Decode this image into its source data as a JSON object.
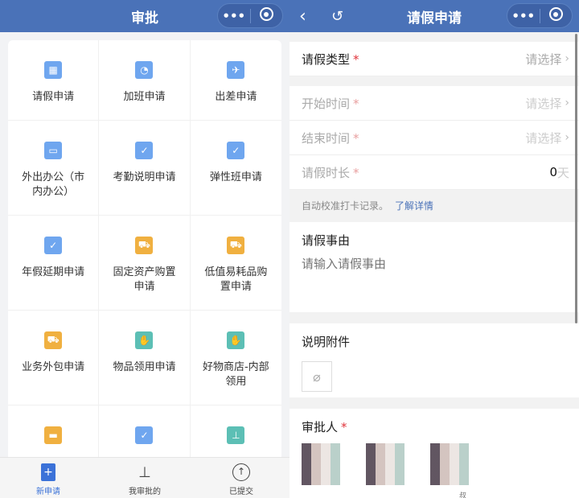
{
  "left": {
    "title": "审批",
    "grid": [
      {
        "label": "请假申请",
        "icon": "calendar-icon",
        "color": "#6fa6ef"
      },
      {
        "label": "加班申请",
        "icon": "user-clock-icon",
        "color": "#6fa6ef"
      },
      {
        "label": "出差申请",
        "icon": "plane-icon",
        "color": "#6fa6ef"
      },
      {
        "label": "外出办公（市内办公）",
        "icon": "briefcase-icon",
        "color": "#6fa6ef"
      },
      {
        "label": "考勤说明申请",
        "icon": "clipboard-check-icon",
        "color": "#6fa6ef"
      },
      {
        "label": "弹性班申请",
        "icon": "clipboard-check-icon",
        "color": "#6fa6ef"
      },
      {
        "label": "年假延期申请",
        "icon": "clipboard-check-icon",
        "color": "#6fa6ef"
      },
      {
        "label": "固定资产购置申请",
        "icon": "cart-icon",
        "color": "#f0b040"
      },
      {
        "label": "低值易耗品购置申请",
        "icon": "cart-icon",
        "color": "#f0b040"
      },
      {
        "label": "业务外包申请",
        "icon": "cart-icon",
        "color": "#f0b040"
      },
      {
        "label": "物品领用申请",
        "icon": "hand-icon",
        "color": "#5cbfb5"
      },
      {
        "label": "好物商店-内部领用",
        "icon": "hand-icon",
        "color": "#5cbfb5"
      },
      {
        "label": "",
        "icon": "wallet-icon",
        "color": "#f0b040"
      },
      {
        "label": "",
        "icon": "clipboard-check-icon",
        "color": "#6fa6ef"
      },
      {
        "label": "",
        "icon": "stamp-icon",
        "color": "#5cbfb5"
      }
    ],
    "tabs": [
      {
        "label": "新申请",
        "active": true
      },
      {
        "label": "我审批的"
      },
      {
        "label": "已提交"
      }
    ]
  },
  "right": {
    "title": "请假申请",
    "leave_type": {
      "label": "请假类型",
      "value": "请选择"
    },
    "start": {
      "label": "开始时间",
      "value": "请选择"
    },
    "end": {
      "label": "结束时间",
      "value": "请选择"
    },
    "duration": {
      "label": "请假时长",
      "value": "0",
      "unit": "天"
    },
    "note": "自动校准打卡记录。",
    "note_link": "了解详情",
    "reason": {
      "label": "请假事由",
      "placeholder": "请输入请假事由"
    },
    "attach": {
      "label": "说明附件"
    },
    "approver": {
      "label": "审批人",
      "name3": "叔"
    }
  },
  "colors": {
    "header": "#4a72b8",
    "accent": "#4a72b8",
    "required": "#e0333b"
  }
}
